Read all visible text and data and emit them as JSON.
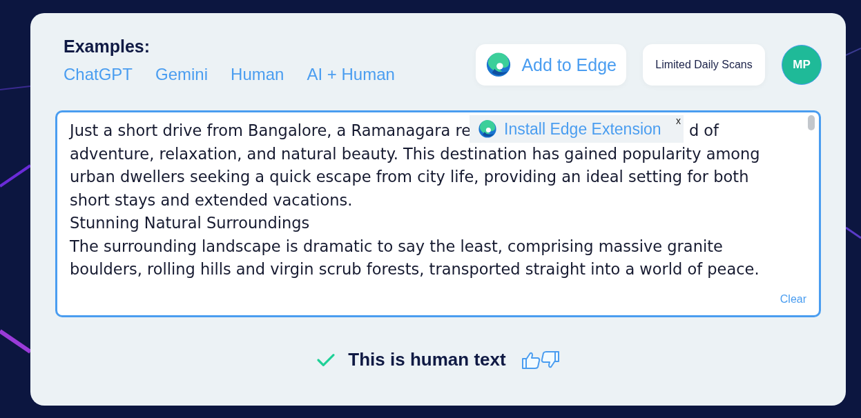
{
  "examples": {
    "heading": "Examples:",
    "links": [
      "ChatGPT",
      "Gemini",
      "Human",
      "AI + Human"
    ]
  },
  "header_buttons": {
    "add_to_edge": "Add to Edge",
    "scans": "Limited Daily Scans",
    "avatar": "MP"
  },
  "editor": {
    "first_line": {
      "before": "Just a short drive from Bangalore, a Ramanagara re",
      "after": "d of"
    },
    "lines": [
      "adventure, relaxation, and natural beauty. This destination has gained popularity among",
      "urban dwellers seeking a quick escape from city life, providing an ideal setting for both",
      "short stays and extended vacations.",
      "Stunning Natural Surroundings",
      "The surrounding landscape is dramatic to say the least, comprising massive granite",
      "boulders, rolling hills and virgin scrub forests, transported straight into a world of peace."
    ],
    "clear": "Clear"
  },
  "popup": {
    "label": "Install Edge Extension",
    "close": "x"
  },
  "result": {
    "verdict": "This is human text"
  }
}
